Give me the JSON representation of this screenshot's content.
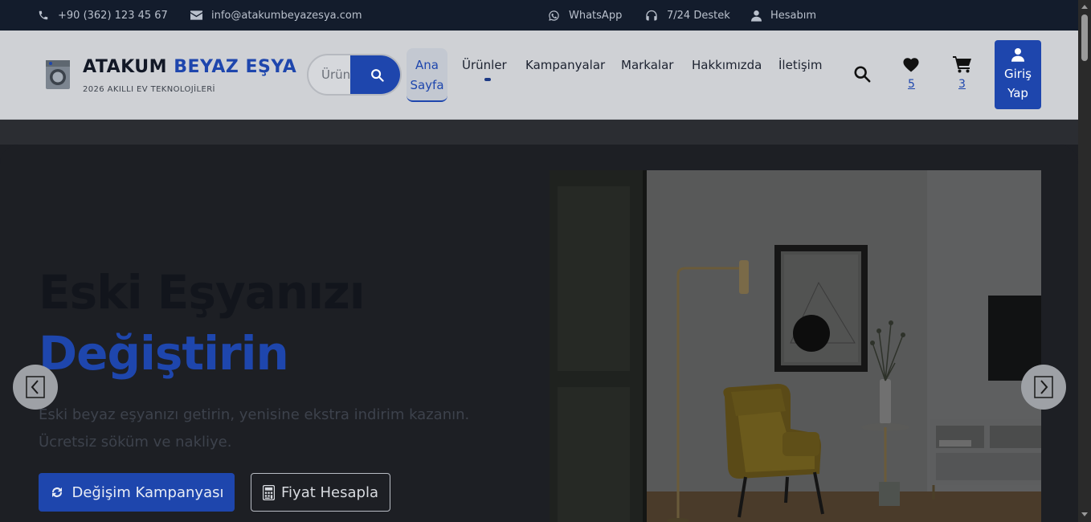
{
  "topbar": {
    "phone": "+90 (362) 123 45 67",
    "email": "info@atakumbeyazesya.com",
    "whatsapp": "WhatsApp",
    "support": "7/24 Destek",
    "account": "Hesabım"
  },
  "brand": {
    "name_part1": "ATAKUM",
    "name_part2": "BEYAZ EŞYA",
    "tagline": "2026 AKILLI EV TEKNOLOJİLERİ"
  },
  "search": {
    "placeholder": "Ürün"
  },
  "nav": {
    "home_line1": "Ana",
    "home_line2": "Sayfa",
    "products": "Ürünler",
    "campaigns": "Kampanyalar",
    "brands": "Markalar",
    "about": "Hakkımızda",
    "contact": "İletişim"
  },
  "header_actions": {
    "favorites_count": "5",
    "cart_count": "3",
    "login_line1": "Giriş",
    "login_line2": "Yap"
  },
  "hero": {
    "title_line1": "Eski Eşyanızı",
    "title_line2": "Değiştirin",
    "description": "Eski beyaz eşyanızı getirin, yenisine ekstra indirim kazanın. Ücretsiz söküm ve nakliye.",
    "primary_button": "Değişim Kampanyası",
    "secondary_button": "Fiyat Hesapla"
  },
  "colors": {
    "accent": "#1e46ad",
    "topbar_bg": "#131c2c",
    "chair": "#c9a426"
  }
}
